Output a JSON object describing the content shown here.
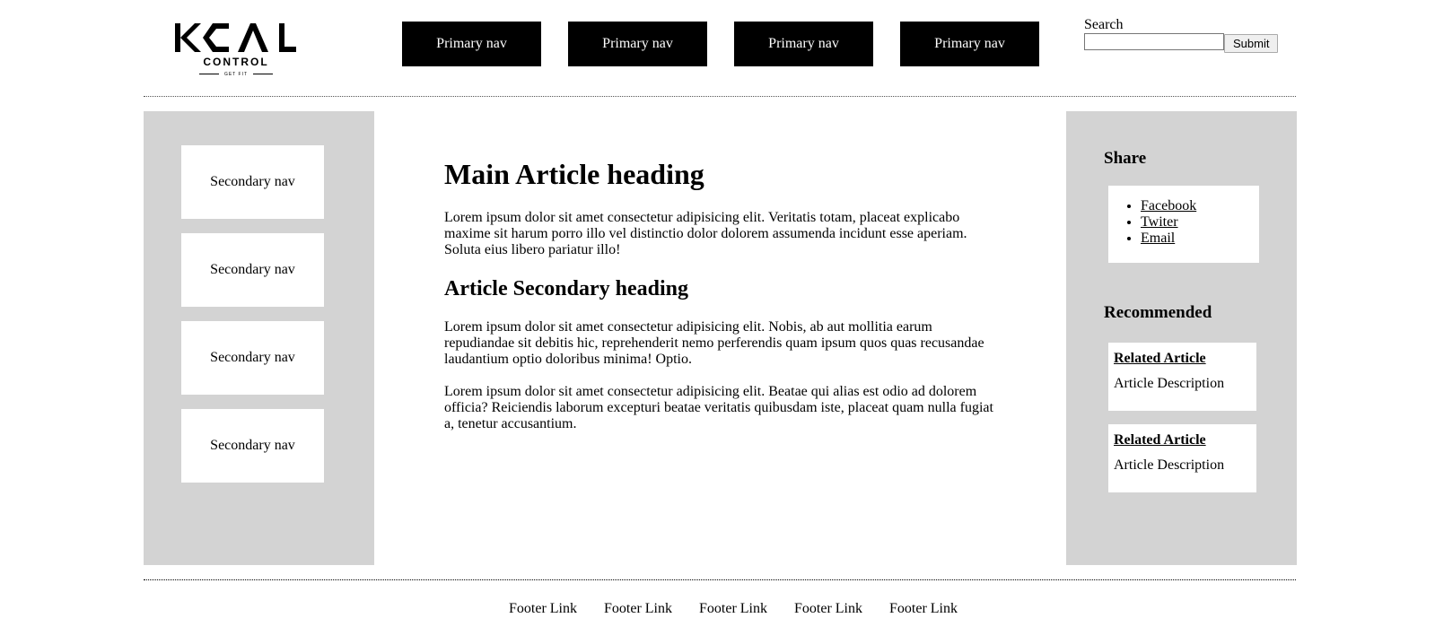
{
  "brand": {
    "name": "KCAL",
    "word": "CONTROL",
    "tagline": "GET FIT"
  },
  "primary_nav": [
    "Primary nav",
    "Primary nav",
    "Primary nav",
    "Primary nav"
  ],
  "search": {
    "label": "Search",
    "value": "",
    "button": "Submit"
  },
  "secondary_nav": [
    "Secondary nav",
    "Secondary nav",
    "Secondary nav",
    "Secondary nav"
  ],
  "article": {
    "heading": "Main Article heading",
    "intro": "Lorem ipsum dolor sit amet consectetur adipisicing elit. Veritatis totam, placeat explicabo maxime sit harum porro illo vel distinctio dolor dolorem assumenda incidunt esse aperiam. Soluta eius libero pariatur illo!",
    "secondary_heading": "Article Secondary heading",
    "para2": "Lorem ipsum dolor sit amet consectetur adipisicing elit. Nobis, ab aut mollitia earum repudiandae sit debitis hic, reprehenderit nemo perferendis quam ipsum quos quas recusandae laudantium optio doloribus minima! Optio.",
    "para3": "Lorem ipsum dolor sit amet consectetur adipisicing elit. Beatae qui alias est odio ad dolorem officia? Reiciendis laborum excepturi beatae veritatis quibusdam iste, placeat quam nulla fugiat a, tenetur accusantium."
  },
  "share": {
    "heading": "Share",
    "links": [
      "Facebook",
      "Twiter",
      "Email"
    ]
  },
  "recommended": {
    "heading": "Recommended",
    "items": [
      {
        "title": "Related Article",
        "desc": "Article Description"
      },
      {
        "title": "Related Article",
        "desc": "Article Description"
      }
    ]
  },
  "footer": [
    "Footer Link",
    "Footer Link",
    "Footer Link",
    "Footer Link",
    "Footer Link"
  ]
}
